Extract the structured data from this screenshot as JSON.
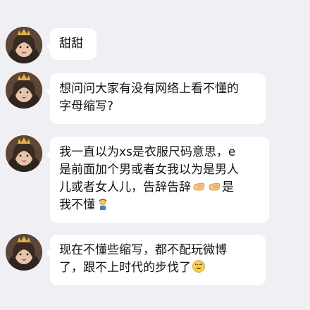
{
  "messages": [
    {
      "avatar": "user-avatar",
      "lines": [
        "甜甜"
      ]
    },
    {
      "avatar": "user-avatar",
      "lines": [
        "想问问大家有没有网络上看不懂的",
        "字母缩写?"
      ]
    },
    {
      "avatar": "user-avatar",
      "lines": [
        "我一直以为xs是衣服尺码意思，e",
        "是前面加个男或者女我以为是男人",
        "儿或者女人儿，告辞告辞",
        "是",
        "我不懂"
      ],
      "emojis": [
        "fist-bump-emoji",
        "fist-bump-emoji",
        "facepalm-emoji"
      ]
    },
    {
      "avatar": "user-avatar",
      "lines": [
        "现在不懂些缩写，都不配玩微博",
        "了，跟不上时代的步伐了"
      ],
      "emojis": [
        "sweat-smile-emoji"
      ]
    }
  ],
  "colors": {
    "background": "#efeff4",
    "bubble": "#ffffff",
    "text": "#141414"
  }
}
